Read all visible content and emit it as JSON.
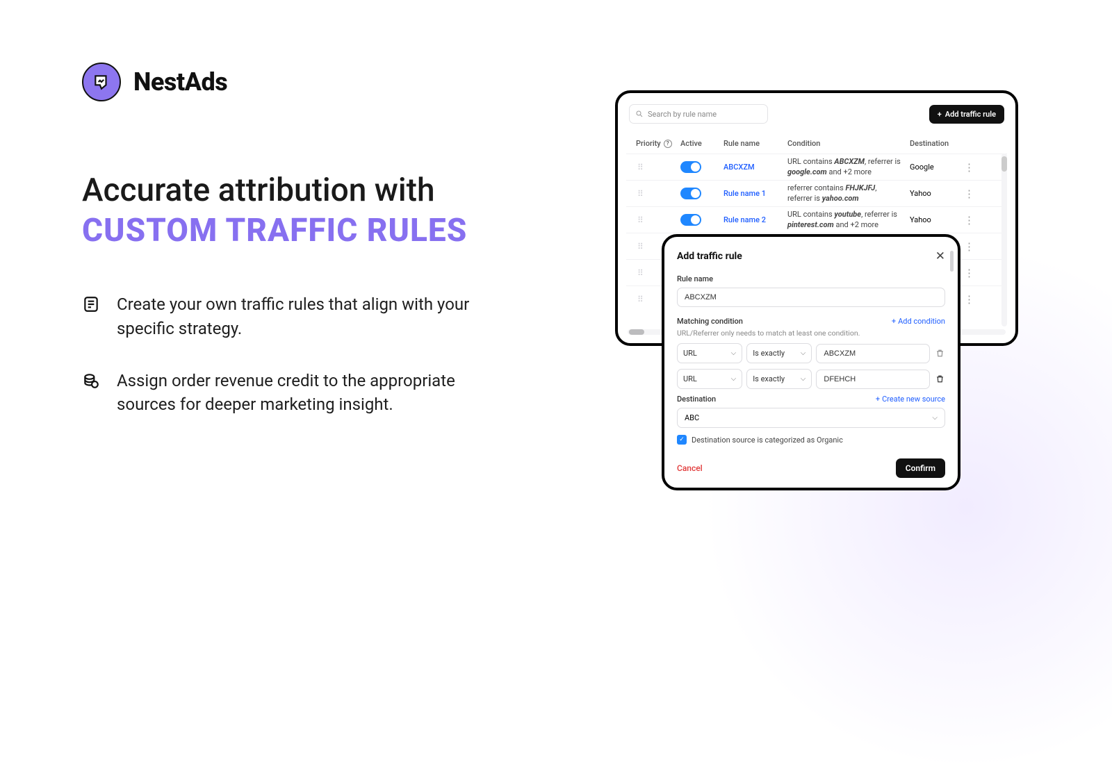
{
  "brand": "NestAds",
  "headline": {
    "line1": "Accurate attribution with",
    "line2": "CUSTOM TRAFFIC RULES"
  },
  "features": [
    "Create your own traffic rules that align with your specific strategy.",
    "Assign order revenue credit to the appropriate sources for deeper marketing insight."
  ],
  "panel": {
    "search_placeholder": "Search by rule name",
    "add_button": "Add traffic rule",
    "columns": {
      "priority": "Priority",
      "active": "Active",
      "rule_name": "Rule name",
      "condition": "Condition",
      "destination": "Destination"
    },
    "rows": [
      {
        "name": "ABCXZM",
        "c_a": "URL contains ",
        "c_b": "ABCXZM",
        "c_c": ", referrer is ",
        "c_d": "google.com",
        "c_e": " and +2 more",
        "dest": "Google"
      },
      {
        "name": "Rule name 1",
        "c_a": "referrer contains ",
        "c_b": "FHJKJFJ",
        "c_c": ", referrer is ",
        "c_d": "yahoo.com",
        "c_e": "",
        "dest": "Yahoo"
      },
      {
        "name": "Rule name 2",
        "c_a": "URL contains ",
        "c_b": "youtube",
        "c_c": ", referrer is ",
        "c_d": "pinterest.com",
        "c_e": " and +2 more",
        "dest": "Yahoo"
      },
      {
        "name": "",
        "c_a": "",
        "c_b": "",
        "c_c": "",
        "c_d": "",
        "c_e": "",
        "dest": ""
      },
      {
        "name": "",
        "c_a": "",
        "c_b": "",
        "c_c": "",
        "c_d": "",
        "c_e": "",
        "dest": ""
      },
      {
        "name": "",
        "c_a": "",
        "c_b": "",
        "c_c": "",
        "c_d": "",
        "c_e": "",
        "dest": ""
      }
    ]
  },
  "modal": {
    "title": "Add traffic rule",
    "rule_name_label": "Rule name",
    "rule_name_value": "ABCXZM",
    "matching_label": "Matching condition",
    "matching_hint": "URL/Referrer only needs to match at least one condition.",
    "add_condition": "Add condition",
    "conditions": [
      {
        "field": "URL",
        "op": "Is exactly",
        "value": "ABCXZM"
      },
      {
        "field": "URL",
        "op": "Is exactly",
        "value": "DFEHCH"
      }
    ],
    "destination_label": "Destination",
    "create_source": "Create new source",
    "destination_value": "ABC",
    "checkbox_label": "Destination source is categorized as Organic",
    "cancel": "Cancel",
    "confirm": "Confirm"
  }
}
